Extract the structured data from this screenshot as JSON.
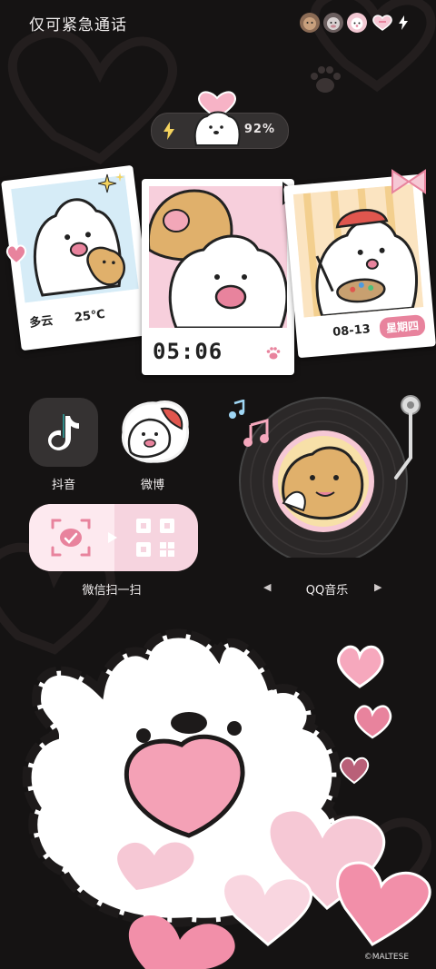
{
  "status_bar": {
    "carrier_text": "仅可紧急通话",
    "icons": [
      "dog-face-icon",
      "cow-face-icon",
      "bunny-face-icon",
      "heart-battery-icon",
      "charging-bolt-icon"
    ]
  },
  "battery": {
    "percent_label": "92%",
    "level": 0.92,
    "charging": true
  },
  "weather": {
    "condition": "多云",
    "temperature": "25℃"
  },
  "clock": {
    "time": "05:06"
  },
  "date": {
    "date": "08-13",
    "weekday": "星期四"
  },
  "apps": [
    {
      "name": "抖音",
      "icon": "tiktok-icon"
    },
    {
      "name": "微博",
      "icon": "dog-sticker-icon"
    }
  ],
  "scan_widget": {
    "label": "微信扫一扫",
    "icons": [
      "wechat-scan-icon",
      "qr-code-icon"
    ]
  },
  "music": {
    "label": "QQ音乐",
    "prev_icon": "◀",
    "next_icon": "▶"
  },
  "watermark": "©MALTESE",
  "colors": {
    "background": "#151313",
    "accent_pink": "#e8839d",
    "light_pink": "#f6d4df",
    "white": "#ffffff"
  }
}
